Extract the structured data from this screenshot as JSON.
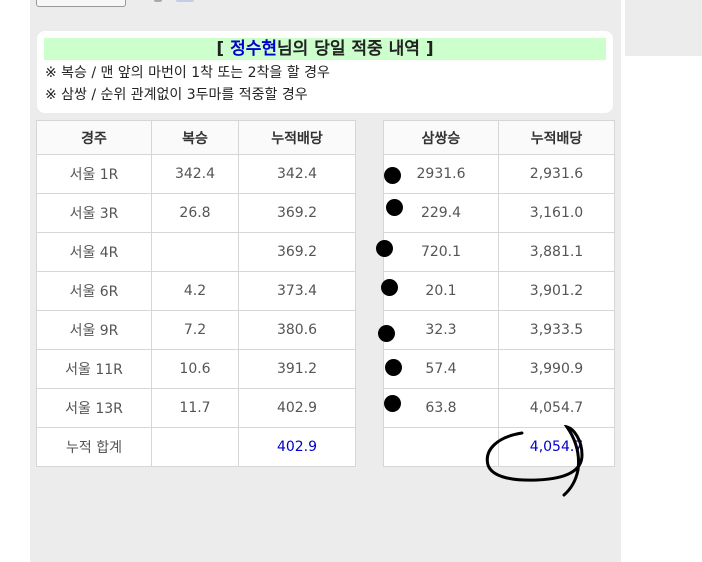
{
  "banner": {
    "bracket_open": "[",
    "name": "정수현",
    "suffix": "님의 당일 적중 내역",
    "bracket_close": "]"
  },
  "notes": [
    "※ 복승 / 맨 앞의 마번이 1착 또는 2착을 할 경우",
    "※ 삼쌍 / 순위 관계없이 3두마를 적중할 경우"
  ],
  "left_table": {
    "headers": [
      "경주",
      "복승",
      "누적배당"
    ],
    "rows": [
      [
        "서울 1R",
        "342.4",
        "342.4"
      ],
      [
        "서울 3R",
        "26.8",
        "369.2"
      ],
      [
        "서울 4R",
        "",
        "369.2"
      ],
      [
        "서울 6R",
        "4.2",
        "373.4"
      ],
      [
        "서울 9R",
        "7.2",
        "380.6"
      ],
      [
        "서울 11R",
        "10.6",
        "391.2"
      ],
      [
        "서울 13R",
        "11.7",
        "402.9"
      ]
    ],
    "total_label": "누적 합계",
    "total_value": "402.9"
  },
  "right_table": {
    "headers": [
      "삼쌍승",
      "누적배당"
    ],
    "rows": [
      [
        "2931.6",
        "2,931.6"
      ],
      [
        "229.4",
        "3,161.0"
      ],
      [
        "720.1",
        "3,881.1"
      ],
      [
        "20.1",
        "3,901.2"
      ],
      [
        "32.3",
        "3,933.5"
      ],
      [
        "57.4",
        "3,990.9"
      ],
      [
        "63.8",
        "4,054.7"
      ]
    ],
    "total_value": "4,054.7"
  },
  "colors": {
    "banner_bg": "#ccffcc",
    "highlight": "#0000cc",
    "panel_bg": "#ececec"
  }
}
